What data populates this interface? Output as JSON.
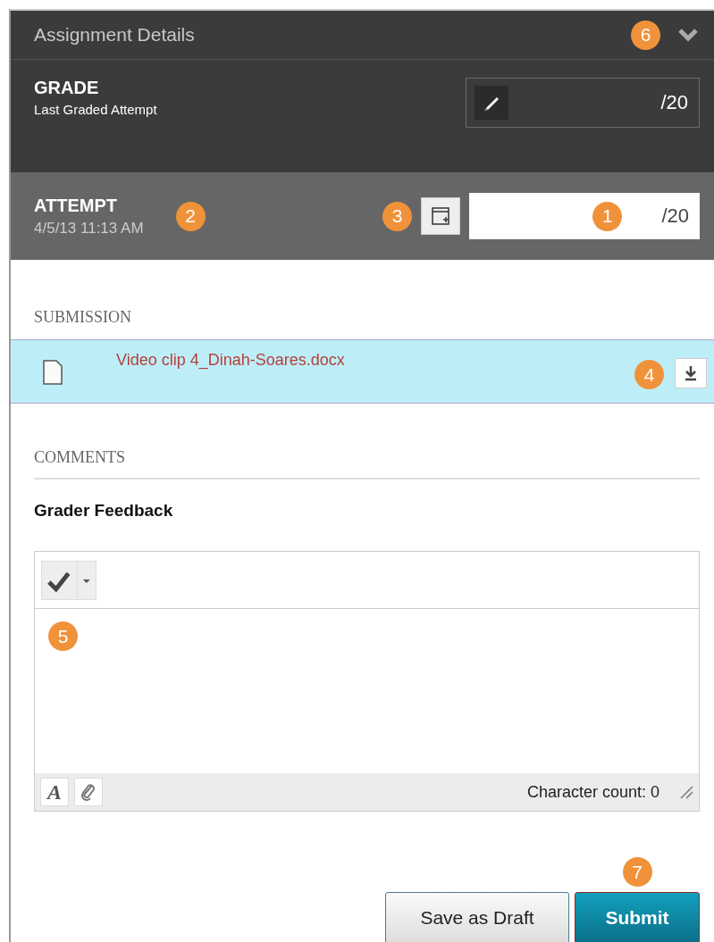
{
  "header": {
    "title": "Assignment Details",
    "callout": "6",
    "expanded": true
  },
  "grade": {
    "title": "GRADE",
    "subtitle": "Last Graded Attempt",
    "out_of": "/20"
  },
  "attempt": {
    "title": "ATTEMPT",
    "date": "4/5/13 11:13 AM",
    "callout_date": "2",
    "callout_icon": "3",
    "callout_field": "1",
    "out_of": "/20"
  },
  "submission": {
    "heading": "SUBMISSION",
    "file": "Video clip 4_Dinah-Soares.docx",
    "callout": "4"
  },
  "comments": {
    "heading": "COMMENTS",
    "label": "Grader Feedback",
    "callout": "5",
    "format_glyph": "A",
    "char_count": "Character count: 0"
  },
  "buttons": [
    {
      "label": "Save as Draft",
      "kind": "secondary"
    },
    {
      "label": "Submit",
      "kind": "primary",
      "callout": "7"
    }
  ]
}
